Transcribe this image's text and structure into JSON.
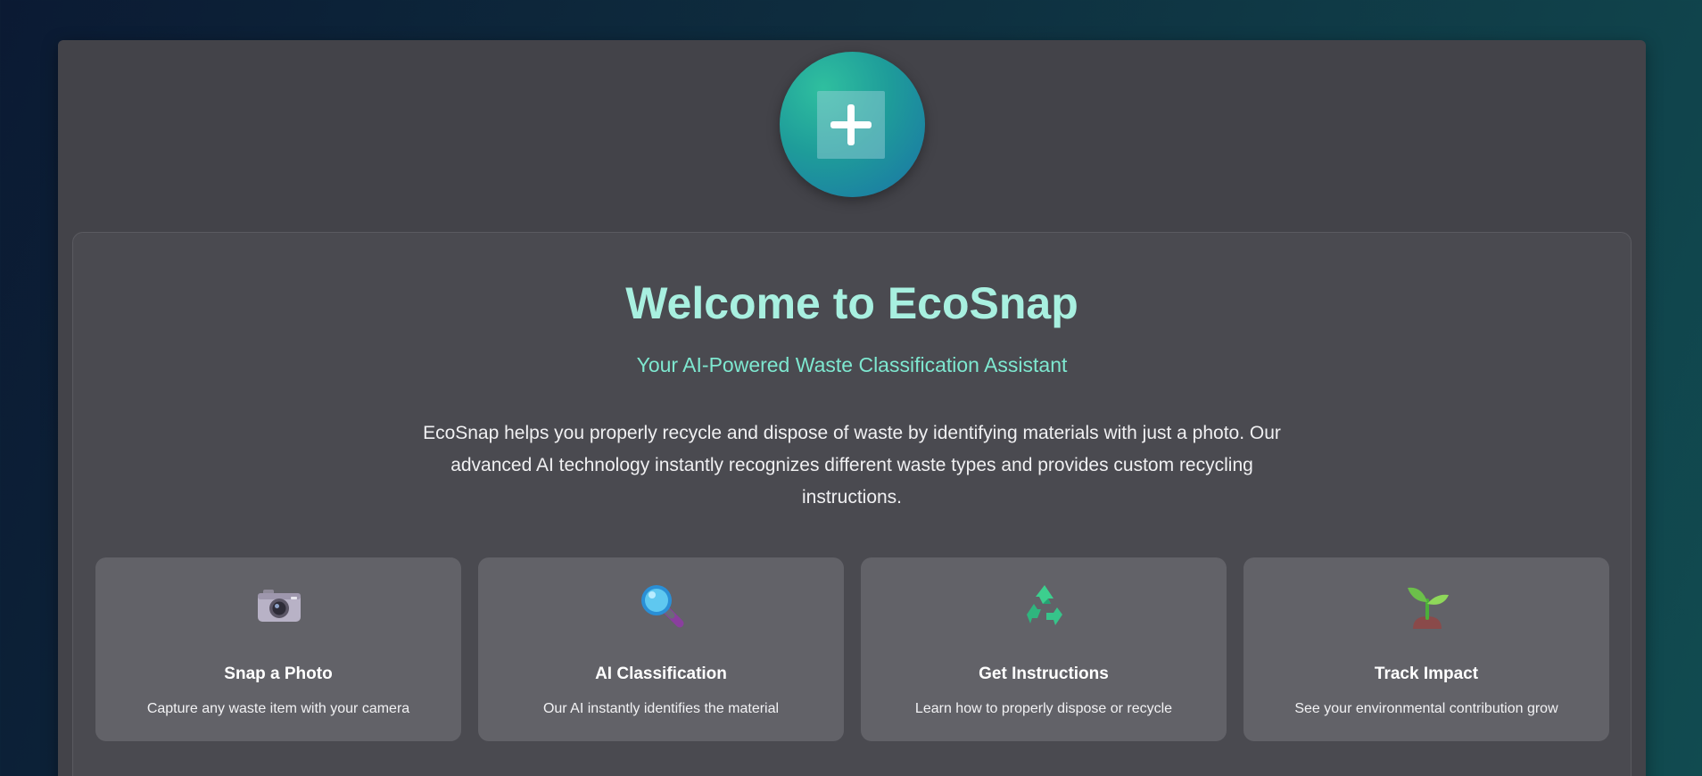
{
  "header": {
    "logo_icon": "plus-icon"
  },
  "welcome": {
    "title": "Welcome to EcoSnap",
    "subtitle": "Your AI-Powered Waste Classification Assistant",
    "description": "EcoSnap helps you properly recycle and dispose of waste by identifying materials with just a photo. Our advanced AI technology instantly recognizes different waste types and provides custom recycling instructions."
  },
  "features": [
    {
      "icon": "camera-icon",
      "title": "Snap a Photo",
      "description": "Capture any waste item with your camera"
    },
    {
      "icon": "magnifier-icon",
      "title": "AI Classification",
      "description": "Our AI instantly identifies the material"
    },
    {
      "icon": "recycle-icon",
      "title": "Get Instructions",
      "description": "Learn how to properly dispose or recycle"
    },
    {
      "icon": "seedling-icon",
      "title": "Track Impact",
      "description": "See your environmental contribution grow"
    }
  ],
  "colors": {
    "accent": "#a8f0e0",
    "subtitle": "#7ee8d0",
    "background_start": "#0b1a33",
    "background_end": "#114b50",
    "card": "#626268"
  }
}
